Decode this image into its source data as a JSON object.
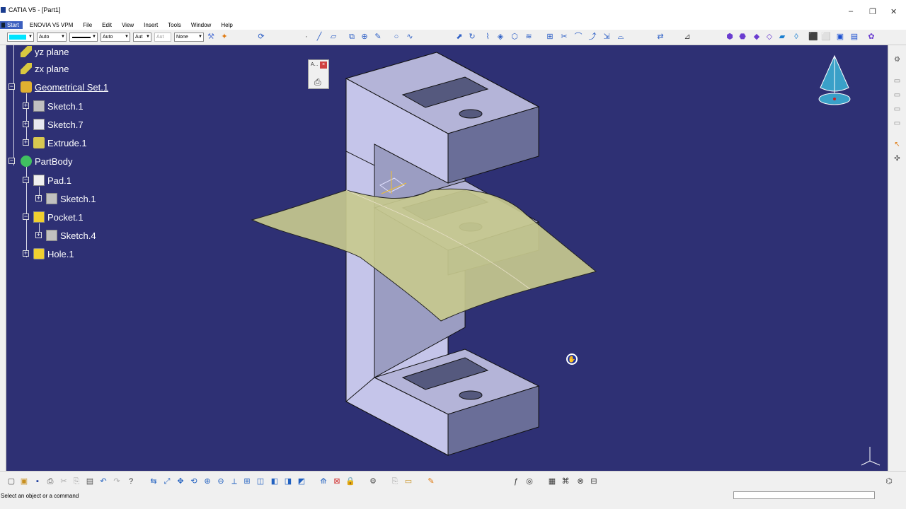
{
  "window": {
    "title": "CATIA V5 - [Part1]",
    "minimize": "–",
    "maximize": "❐",
    "close": "✕"
  },
  "menu": {
    "start": "Start",
    "items": [
      "ENOVIA V5 VPM",
      "File",
      "Edit",
      "View",
      "Insert",
      "Tools",
      "Window",
      "Help"
    ]
  },
  "toolbar": {
    "color_swatch": "#00e5ff",
    "line_type_value": "Auto",
    "line_weight_value": "Auto",
    "layer_value": "Aut",
    "layer2_value": "Aut",
    "symbol_value": "None"
  },
  "tree": {
    "nodes": [
      {
        "label": "yz plane",
        "icon": "plane-icon"
      },
      {
        "label": "zx plane",
        "icon": "plane-icon"
      },
      {
        "label": "Geometrical Set.1",
        "icon": "geometrical-set-icon"
      },
      {
        "label": "Sketch.1",
        "icon": "sketch-icon"
      },
      {
        "label": "Sketch.7",
        "icon": "sketch-icon"
      },
      {
        "label": "Extrude.1",
        "icon": "extrude-icon"
      },
      {
        "label": "PartBody",
        "icon": "partbody-icon"
      },
      {
        "label": "Pad.1",
        "icon": "pad-icon"
      },
      {
        "label": "Sketch.1",
        "icon": "sketch-icon"
      },
      {
        "label": "Pocket.1",
        "icon": "pocket-icon"
      },
      {
        "label": "Sketch.4",
        "icon": "sketch-icon"
      },
      {
        "label": "Hole.1",
        "icon": "hole-icon"
      }
    ]
  },
  "viewport": {
    "background": "#2e3074",
    "model_face_top": "#b4b4d8",
    "model_face_front": "#6a6e98",
    "model_face_side": "#c5c5ea",
    "surface_color": "#c7c98e",
    "mini_panel_label": "A..."
  },
  "status": {
    "message": "Select an object or a command"
  }
}
